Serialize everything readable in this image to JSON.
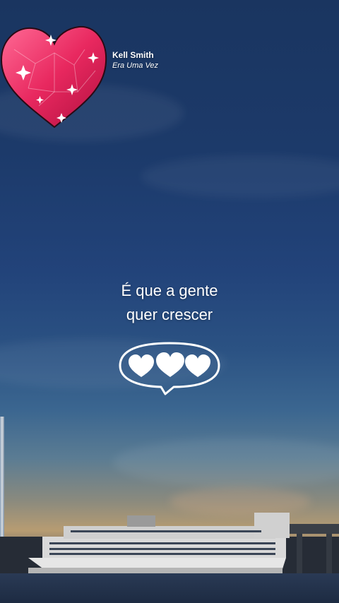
{
  "song": {
    "artist": "Kell Smith",
    "title": "Era Uma Vez",
    "icon": "sparkling-heart-icon"
  },
  "lyrics": {
    "line1": "É que a gente",
    "line2": "quer crescer"
  },
  "reaction": {
    "icon": "hearts-speech-bubble-icon",
    "hearts": 3
  },
  "colors": {
    "heart_pink": "#e8285f",
    "sky_top": "#1a3560",
    "horizon": "#b79c72"
  }
}
